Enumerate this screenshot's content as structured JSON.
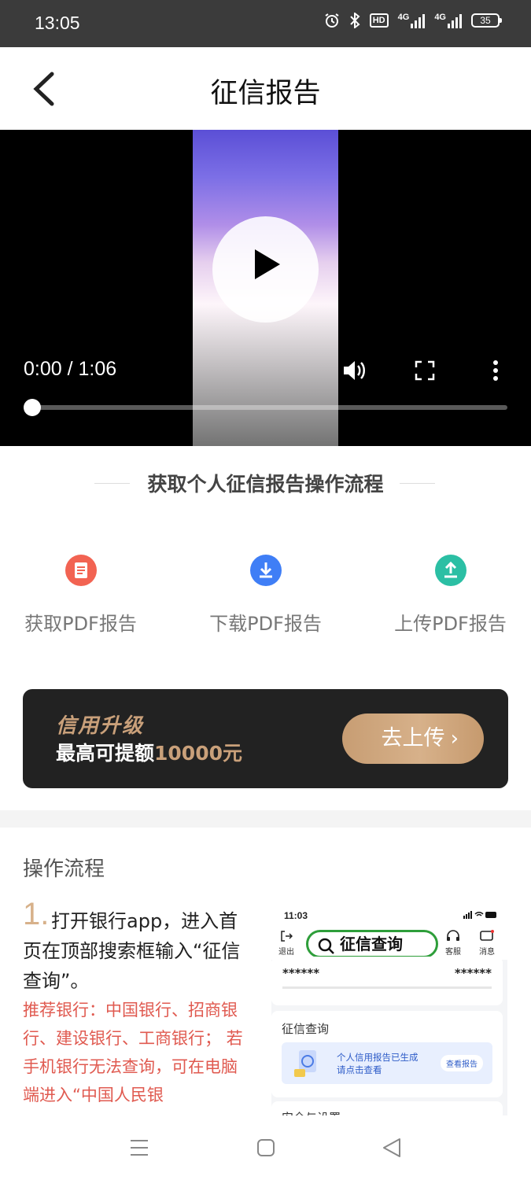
{
  "status_bar": {
    "time": "13:05",
    "network_1": "4G",
    "network_2": "4G",
    "hd_label": "HD",
    "battery": "35",
    "icons": [
      "alarm-icon",
      "bluetooth-icon",
      "hd-icon",
      "signal-icon",
      "signal-icon",
      "battery-icon"
    ]
  },
  "header": {
    "title": "征信报告",
    "back_icon": "chevron-left-icon"
  },
  "video": {
    "time_display": "0:00 / 1:06",
    "progress": 0.0,
    "icons": [
      "play-icon",
      "volume-icon",
      "fullscreen-icon",
      "more-vert-icon"
    ]
  },
  "process": {
    "title": "获取个人征信报告操作流程",
    "steps": [
      {
        "label": "获取PDF报告",
        "icon": "document-icon",
        "color": "#f26352"
      },
      {
        "label": "下载PDF报告",
        "icon": "download-icon",
        "color": "#3f7ef6"
      },
      {
        "label": "上传PDF报告",
        "icon": "upload-icon",
        "color": "#2bbfa4"
      }
    ]
  },
  "banner": {
    "headline": "信用升级",
    "sub_prefix": "最高可提额",
    "sub_amount": "10000元",
    "button_label": "去上传",
    "accent": "#c9a07a"
  },
  "flow": {
    "title": "操作流程",
    "step_number": "1.",
    "step_text": "打开银行app，进入首页在顶部搜索框输入“征信查询”。",
    "recommend": "推荐银行：中国银行、招商银行、建设银行、工商银行； 若手机银行无法查询，可在电脑端进入“中国人民银"
  },
  "phone_shot": {
    "time": "11:03",
    "search_text": "征信查询",
    "left_label": "退出",
    "right_label_1": "客服",
    "right_label_2": "消息",
    "masked_left": "******",
    "masked_right": "******",
    "card_title": "征信查询",
    "info_line_1": "个人信用报告已生成",
    "info_line_2": "请点击查看",
    "view_button": "查看报告",
    "next_section": "安全与设置"
  },
  "nav_bar": {
    "icons": [
      "menu-icon",
      "home-square-icon",
      "back-triangle-icon"
    ]
  }
}
